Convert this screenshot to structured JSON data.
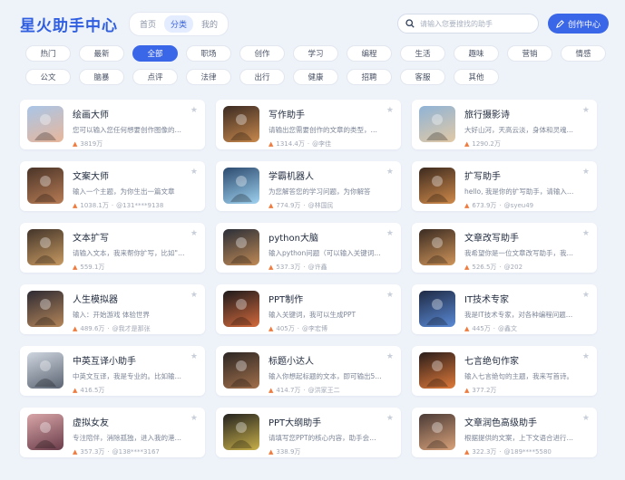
{
  "header": {
    "brand": "星火助手中心",
    "tabs": [
      "首页",
      "分类",
      "我的"
    ],
    "active_tab": 1,
    "search_placeholder": "请输入您要搜找的助手",
    "create_label": "创作中心"
  },
  "categories": {
    "row1": [
      "热门",
      "最新",
      "全部",
      "职场",
      "创作",
      "学习",
      "编程",
      "生活",
      "趣味",
      "营销",
      "情感"
    ],
    "row2": [
      "公文",
      "脑暴",
      "点评",
      "法律",
      "出行",
      "健康",
      "招聘",
      "客服",
      "其他"
    ],
    "active": "全部"
  },
  "cards": [
    {
      "title": "绘画大师",
      "desc": "您可以输入您任何想要创作图像的主题...",
      "count": "3819万",
      "author": "",
      "thumb_colors": [
        "#a9c6e8",
        "#e8b69a"
      ]
    },
    {
      "title": "写作助手",
      "desc": "请输出您需要创作的文章的类型，以及文...",
      "count": "1314.4万",
      "author": "@李佳",
      "thumb_colors": [
        "#3a2a22",
        "#c9894d"
      ]
    },
    {
      "title": "旅行摄影诗",
      "desc": "大好山河，天高云淡，身体和灵魂总有...",
      "count": "1290.2万",
      "author": "",
      "thumb_colors": [
        "#8fb3d6",
        "#e2c9a6"
      ]
    },
    {
      "title": "文案大师",
      "desc": "输入一个主题，为你生出一篇文章",
      "count": "1038.1万",
      "author": "@131****9138",
      "thumb_colors": [
        "#4a3428",
        "#b87c55"
      ]
    },
    {
      "title": "学霸机器人",
      "desc": "为您解答您的学习问题，为你解答",
      "count": "774.9万",
      "author": "@林国民",
      "thumb_colors": [
        "#2c4a6e",
        "#9fd2f0"
      ]
    },
    {
      "title": "扩写助手",
      "desc": "hello, 我是你的扩写助手，请输入文本...",
      "count": "673.9万",
      "author": "@syeu49",
      "thumb_colors": [
        "#3c2a1f",
        "#d08a4a"
      ]
    },
    {
      "title": "文本扩写",
      "desc": "请输入文本，我来帮你扩写，比如\"大造...",
      "count": "559.1万",
      "author": "",
      "thumb_colors": [
        "#43352a",
        "#c89a62"
      ]
    },
    {
      "title": "python大脑",
      "desc": "输入python问题（可以输入关键词，可...",
      "count": "537.3万",
      "author": "@许鑫",
      "thumb_colors": [
        "#2a2e38",
        "#c08a55"
      ]
    },
    {
      "title": "文章改写助手",
      "desc": "我希望你是一位文章改写助手，我给出...",
      "count": "526.5万",
      "author": "@202",
      "thumb_colors": [
        "#3a2b22",
        "#d0955a"
      ]
    },
    {
      "title": "人生模拟器",
      "desc": "输入：开始游戏 体验世界",
      "count": "489.6万",
      "author": "@我才是那张",
      "thumb_colors": [
        "#2d2a33",
        "#b58659"
      ]
    },
    {
      "title": "PPT制作",
      "desc": "输入关键词，我可以生成PPT",
      "count": "405万",
      "author": "@李宏博",
      "thumb_colors": [
        "#1d1a1c",
        "#d46a3c"
      ]
    },
    {
      "title": "IT技术专家",
      "desc": "我是IT技术专家，对各种编程问题都有一...",
      "count": "445万",
      "author": "@鑫文",
      "thumb_colors": [
        "#1f2a44",
        "#5a8ad6"
      ]
    },
    {
      "title": "中英互译小助手",
      "desc": "中英文互译，我是专业的。比如输入：...",
      "count": "416.5万",
      "author": "",
      "thumb_colors": [
        "#cfd6e0",
        "#5b6472"
      ]
    },
    {
      "title": "标题小达人",
      "desc": "输入你想起标题的文本，即可输出5个文...",
      "count": "414.7万",
      "author": "@洪家王二",
      "thumb_colors": [
        "#2c2624",
        "#a2704b"
      ]
    },
    {
      "title": "七言绝句作家",
      "desc": "输入七言绝句的主题，我来写首诗。",
      "count": "377.2万",
      "author": "",
      "thumb_colors": [
        "#2a1d1a",
        "#e07a3a"
      ]
    },
    {
      "title": "虚拟女友",
      "desc": "专注陪伴，消除孤独，进入我的港湾~",
      "count": "357.3万",
      "author": "@138****3167",
      "thumb_colors": [
        "#d8a6a8",
        "#6a3c4a"
      ]
    },
    {
      "title": "PPT大纲助手",
      "desc": "请填写您PPT的核心内容，助手会提供PP...",
      "count": "338.9万",
      "author": "",
      "thumb_colors": [
        "#23221f",
        "#c8b04a"
      ]
    },
    {
      "title": "文章润色高级助手",
      "desc": "根据提供的文案，上下文语合进行润色",
      "count": "322.3万",
      "author": "@189****5580",
      "thumb_colors": [
        "#4a3a36",
        "#d9a27a"
      ]
    }
  ]
}
